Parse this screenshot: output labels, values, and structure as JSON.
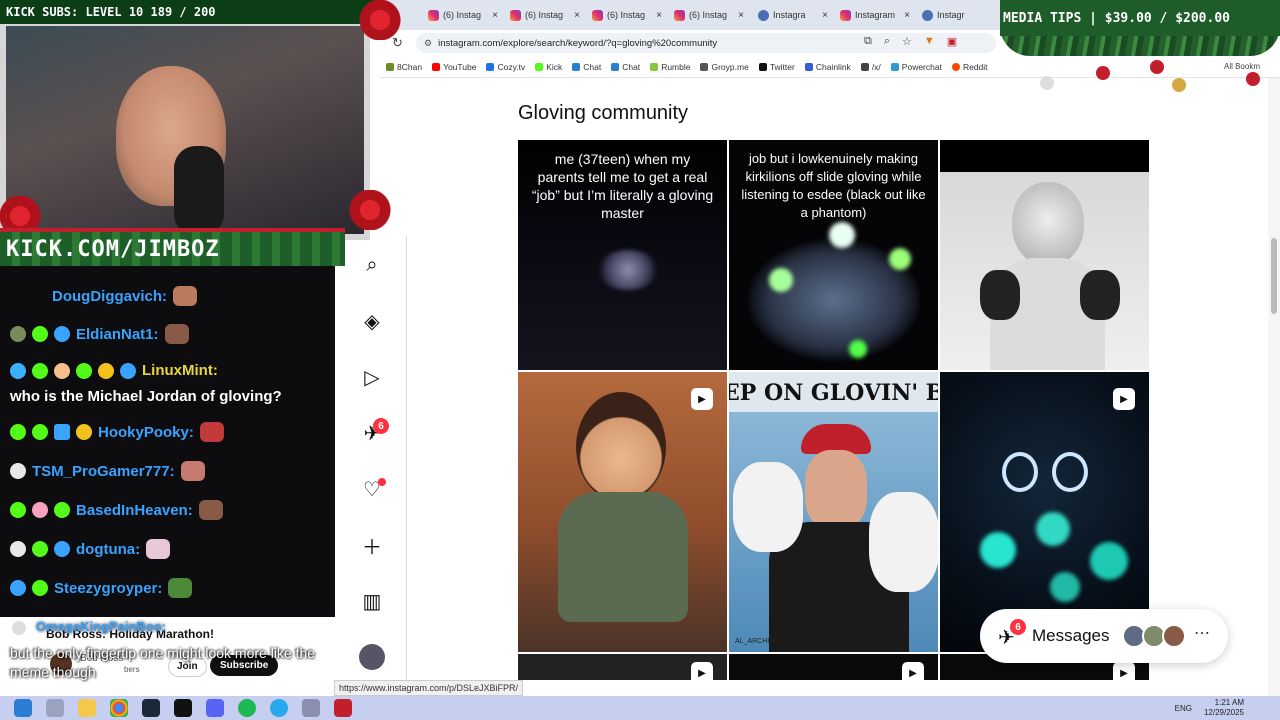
{
  "overlays": {
    "kick_subs": "KICK SUBS: LEVEL 10 189 / 200",
    "media_tips": "MEDIA TIPS | $39.00 / $200.00",
    "channel_banner": "KICK.COM/JIMBOZ"
  },
  "browser": {
    "tabs": [
      {
        "label": "(6) Instag"
      },
      {
        "label": "(6) Instag"
      },
      {
        "label": "(6) Instag"
      },
      {
        "label": "(6) Instag"
      },
      {
        "label": "Instagra"
      },
      {
        "label": "Instagram"
      },
      {
        "label": "Instagr"
      }
    ],
    "url": "instagram.com/explore/search/keyword/?q=gloving%20community",
    "bookmarks": [
      "8Chan",
      "YouTube",
      "Cozy.tv",
      "Kick",
      "Chat",
      "Chat",
      "Rumble",
      "Groyp.me",
      "Twitter",
      "Chainlink",
      "/x/",
      "Powerchat",
      "Reddit"
    ],
    "all_bookmarks": "All Bookm",
    "status_url": "https://www.instagram.com/p/DSLeJXBiFPR/"
  },
  "chat": {
    "messages": [
      {
        "user": "DougDiggavich:",
        "color": "#3aa2ff"
      },
      {
        "user": "EldianNat1:",
        "color": "#3aa2ff"
      },
      {
        "user": "LinuxMint:",
        "color": "#e8d63b",
        "text": "who is the Michael Jordan of gloving?"
      },
      {
        "user": "HookyPooky:",
        "color": "#3aa2ff"
      },
      {
        "user": "TSM_ProGamer777:",
        "color": "#3aa2ff"
      },
      {
        "user": "BasedInHeaven:",
        "color": "#3aa2ff"
      },
      {
        "user": "dogtuna:",
        "color": "#3aa2ff"
      },
      {
        "user": "Steezygroyper:",
        "color": "#3aa2ff"
      }
    ],
    "overlay_user": "OmegaKingPainBoo:",
    "overlay_text": "but the only fingertip one might look more like the meme though",
    "youtube_card": {
      "title": "Bob Ross: Holiday Marathon!",
      "channel": "Bob Ross",
      "subtitle": "bers",
      "join": "Join",
      "subscribe": "Subscribe"
    }
  },
  "instagram": {
    "page_title": "Gloving community",
    "nav_badges": {
      "explore": "6"
    },
    "tiles": [
      {
        "caption": "me (37teen) when my parents tell me to get a real “job” but I’m literally a gloving master"
      },
      {
        "caption": "job but i lowkenuinely making kirkilions off slide gloving while listening to esdee (black out like a phantom)"
      },
      {
        "caption": ""
      },
      {
        "caption": ""
      },
      {
        "caption": "EP ON GLOVIN' BAE",
        "watermark": "AL_ARCHIVE"
      },
      {
        "caption": ""
      }
    ],
    "messages": {
      "label": "Messages",
      "badge": "6"
    }
  },
  "taskbar": {
    "lang": "ENG",
    "time": "1:21 AM",
    "date": "12/29/2025",
    "tray_badge": "72"
  },
  "colors": {
    "accent": "#ff3040",
    "chat_bg": "#0d0d0f",
    "garland": "#1e5c2a"
  }
}
